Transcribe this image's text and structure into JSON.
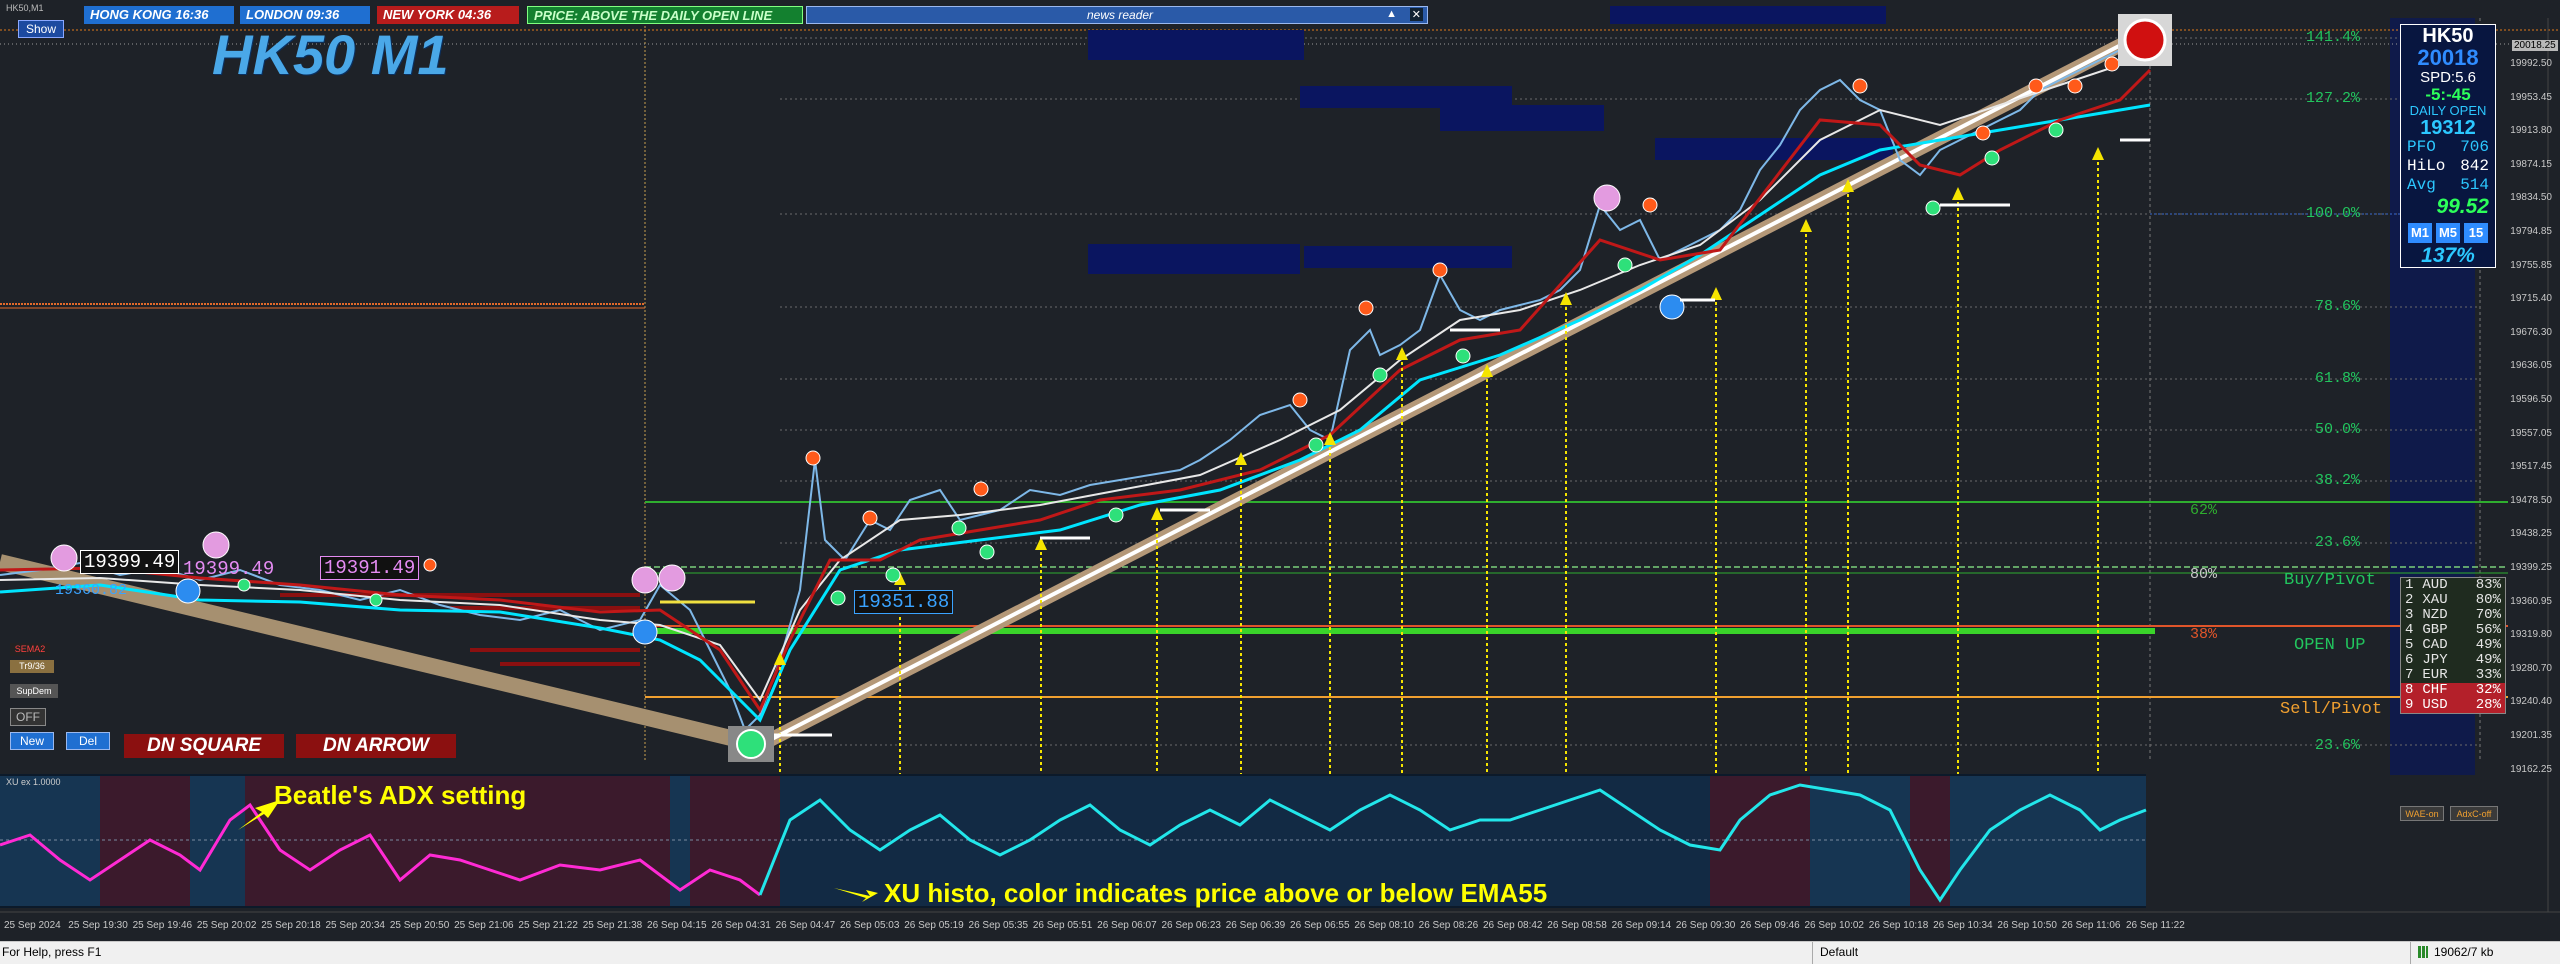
{
  "window": {
    "title": "HK50,M1",
    "show_button": "Show"
  },
  "sessions": [
    {
      "label": "HONG KONG 16:36",
      "bg": "#1f6fd1"
    },
    {
      "label": "LONDON 09:36",
      "bg": "#1f6fd1"
    },
    {
      "label": "NEW YORK 04:36",
      "bg": "#b81c1c"
    },
    {
      "label": "PRICE: ABOVE THE DAILY OPEN LINE",
      "bg": "#13802f"
    }
  ],
  "news_reader": {
    "label": "news reader",
    "arrow": "▲",
    "close": "✕"
  },
  "symbol_title": "HK50 M1",
  "info_panel": {
    "symbol": "HK50",
    "price": "20018",
    "spread": "SPD:5.6",
    "change": "-5:-45",
    "daily_open_label": "DAILY OPEN",
    "daily_open_value": "19312",
    "pfo_label": "PFO",
    "pfo_value": "706",
    "hilo_label": "HiLo",
    "hilo_value": "842",
    "avg_label": "Avg",
    "avg_value": "514",
    "ratio": "99.52",
    "timeframes": [
      "M1",
      "M5",
      "15"
    ],
    "percent": "137%"
  },
  "fib_levels": [
    {
      "label": "141.4%"
    },
    {
      "label": "127.2%"
    },
    {
      "label": "100.0%"
    },
    {
      "label": "78.6%"
    },
    {
      "label": "61.8%"
    },
    {
      "label": "50.0%"
    },
    {
      "label": "38.2%"
    },
    {
      "label": "23.6%"
    },
    {
      "label": "23.6%"
    }
  ],
  "pivot_labels": {
    "p62": "62%",
    "p80": "80%",
    "buy_pivot": "Buy/Pivot",
    "p38": "38%",
    "open_up": "OPEN UP",
    "sell_pivot": "Sell/Pivot"
  },
  "price_axis": [
    "19992.50",
    "19953.45",
    "19913.80",
    "19874.15",
    "19834.50",
    "19794.85",
    "19755.85",
    "19715.40",
    "19676.30",
    "19636.05",
    "19596.50",
    "19557.05",
    "19517.45",
    "19478.50",
    "19438.25",
    "19399.25",
    "19360.95",
    "19319.80",
    "19280.70",
    "19240.40",
    "19201.35",
    "19162.25"
  ],
  "current_price_tag": "20018.25",
  "chart_labels": [
    {
      "text": "19399.49",
      "color": "#ffffff"
    },
    {
      "text": "19399.49",
      "color": "#e48bf2"
    },
    {
      "text": "19391.49",
      "color": "#e48bf2"
    },
    {
      "text": "19351.88",
      "color": "#3aa3ff"
    },
    {
      "text": "19360.82",
      "color": "#3aa3ff"
    }
  ],
  "left_controls": {
    "sema2": "SEMA2",
    "tr": "Tr9/36",
    "supdem": "SupDem",
    "off": "OFF",
    "new": "New",
    "del": "Del",
    "dn_square": "DN SQUARE",
    "dn_arrow": "DN ARROW"
  },
  "currency_strength": [
    {
      "rank": "1",
      "ccy": "AUD",
      "pct": "83%",
      "color": "#e6e6e6",
      "bg": "#1f2b1f"
    },
    {
      "rank": "2",
      "ccy": "XAU",
      "pct": "80%",
      "color": "#e6e6e6",
      "bg": "#1f2b1f"
    },
    {
      "rank": "3",
      "ccy": "NZD",
      "pct": "70%",
      "color": "#e6e6e6",
      "bg": "#1f2b1f"
    },
    {
      "rank": "4",
      "ccy": "GBP",
      "pct": "56%",
      "color": "#e6e6e6",
      "bg": "#1f2b1f"
    },
    {
      "rank": "5",
      "ccy": "CAD",
      "pct": "49%",
      "color": "#e6e6e6",
      "bg": "#1f2b1f"
    },
    {
      "rank": "6",
      "ccy": "JPY",
      "pct": "49%",
      "color": "#e6e6e6",
      "bg": "#1f2b1f"
    },
    {
      "rank": "7",
      "ccy": "EUR",
      "pct": "33%",
      "color": "#e6e6e6",
      "bg": "#1f2b1f"
    },
    {
      "rank": "8",
      "ccy": "CHF",
      "pct": "32%",
      "color": "#ffffff",
      "bg": "#b4202a"
    },
    {
      "rank": "9",
      "ccy": "USD",
      "pct": "28%",
      "color": "#ffffff",
      "bg": "#b4202a"
    }
  ],
  "subwindow": {
    "title": "XU ex 1.0000",
    "wae_on": "WAE-on",
    "adx_off": "AdxC-off",
    "annotation_adx": "Beatle's ADX setting",
    "annotation_xu": "XU histo, color indicates price above or below EMA55"
  },
  "time_axis": [
    "25 Sep 2024",
    "25 Sep 19:30",
    "25 Sep 19:46",
    "25 Sep 20:02",
    "25 Sep 20:18",
    "25 Sep 20:34",
    "25 Sep 20:50",
    "25 Sep 21:06",
    "25 Sep 21:22",
    "25 Sep 21:38",
    "26 Sep 04:15",
    "26 Sep 04:31",
    "26 Sep 04:47",
    "26 Sep 05:03",
    "26 Sep 05:19",
    "26 Sep 05:35",
    "26 Sep 05:51",
    "26 Sep 06:07",
    "26 Sep 06:23",
    "26 Sep 06:39",
    "26 Sep 06:55",
    "26 Sep 08:10",
    "26 Sep 08:26",
    "26 Sep 08:42",
    "26 Sep 08:58",
    "26 Sep 09:14",
    "26 Sep 09:30",
    "26 Sep 09:46",
    "26 Sep 10:02",
    "26 Sep 10:18",
    "26 Sep 10:34",
    "26 Sep 10:50",
    "26 Sep 11:06",
    "26 Sep 11:22"
  ],
  "status_bar": {
    "help": "For Help, press F1",
    "profile": "Default",
    "traffic": "19062/7 kb"
  },
  "colors": {
    "background": "#1e2228",
    "panel": "#101a3a",
    "fib": "#22c55e",
    "arrow": "#ffff00",
    "ema": "#00e5ff",
    "trendline": "#f0e6d0"
  }
}
